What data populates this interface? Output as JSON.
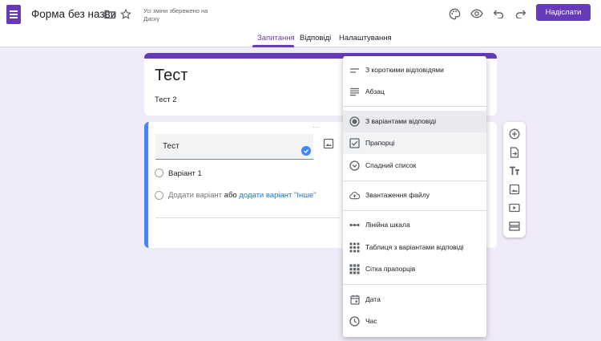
{
  "header": {
    "doc_title": "Форма без назви",
    "save_status": "Усі зміни збережено на Диску",
    "send_label": "Надіслати",
    "icons": [
      "folder-icon",
      "star-icon",
      "palette-icon",
      "eye-icon",
      "undo-icon",
      "redo-icon"
    ]
  },
  "tabs": [
    {
      "label": "Запитання",
      "active": true
    },
    {
      "label": "Відповіді",
      "active": false
    },
    {
      "label": "Налаштування",
      "active": false
    }
  ],
  "form": {
    "title": "Тест",
    "description": "Тест 2"
  },
  "question": {
    "text": "Тест",
    "options": [
      "Варіант 1"
    ],
    "add_option": "Додати варіант",
    "or": "або",
    "add_other": "додати варіант \"Інше\""
  },
  "menu": {
    "items": [
      {
        "label": "З короткими відповідями",
        "icon": "short-answer-icon"
      },
      {
        "label": "Абзац",
        "icon": "paragraph-icon"
      },
      {
        "label": "З варіантами відповіді",
        "icon": "radio-icon",
        "state": "selected"
      },
      {
        "label": "Прапорці",
        "icon": "checkbox-icon",
        "state": "hover"
      },
      {
        "label": "Спадний список",
        "icon": "dropdown-icon"
      },
      {
        "label": "Звантаження файлу",
        "icon": "upload-icon"
      },
      {
        "label": "Лінійна шкала",
        "icon": "linear-scale-icon"
      },
      {
        "label": "Таблиця з варіантами відповіді",
        "icon": "grid-icon"
      },
      {
        "label": "Сітка прапорців",
        "icon": "checkbox-grid-icon"
      },
      {
        "label": "Дата",
        "icon": "calendar-icon"
      },
      {
        "label": "Час",
        "icon": "clock-icon"
      }
    ]
  },
  "side_tools": [
    "add-question-icon",
    "import-icon",
    "title-text-icon",
    "image-icon",
    "video-icon",
    "section-icon"
  ],
  "colors": {
    "accent": "#673ab7",
    "focus": "#4285f4",
    "background": "#f0ebf8"
  }
}
